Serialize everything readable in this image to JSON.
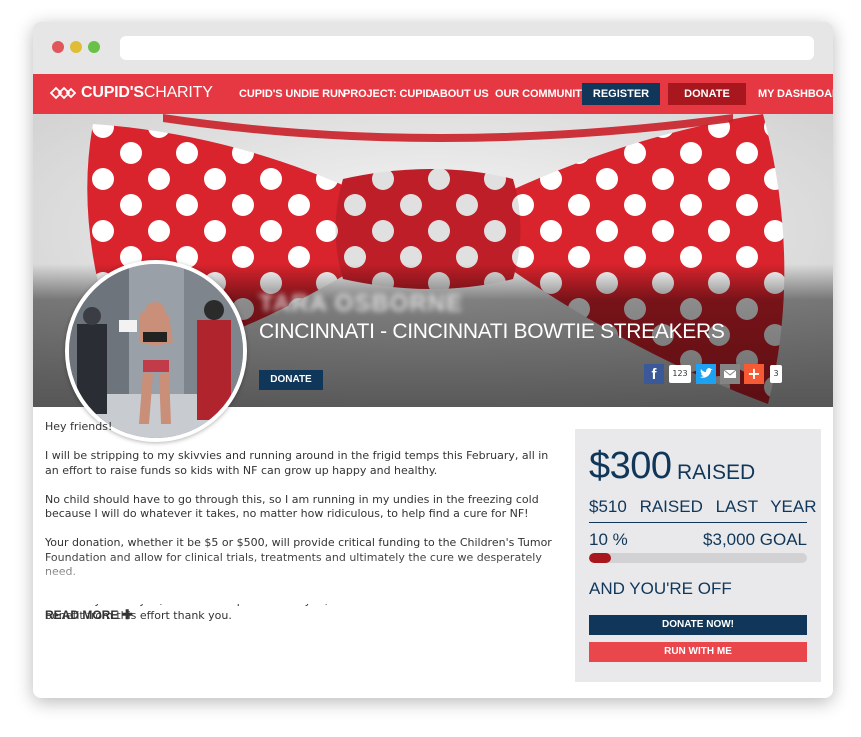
{
  "window": {
    "dots": [
      "#e0575b",
      "#dfbd37",
      "#6ac148"
    ]
  },
  "nav": {
    "logo_bold": "CUPID'S",
    "logo_light": "CHARITY",
    "items": [
      "CUPID'S UNDIE RUN",
      "PROJECT: CUPID",
      "ABOUT US",
      "OUR COMMUNITY"
    ],
    "register_label": "REGISTER",
    "donate_label": "DONATE",
    "dashboard_label": "MY DASHBOARD",
    "colors": {
      "bar": "#e63843",
      "register": "#10375a",
      "donate": "#a8171d"
    }
  },
  "hero": {
    "participant_name": "TARA OSBORNE",
    "team": "CINCINNATI - CINCINNATI BOWTIE STREAKERS",
    "donate_label": "DONATE",
    "share": {
      "facebook_icon": "facebook-icon",
      "facebook_count": "123",
      "twitter_icon": "twitter-icon",
      "email_icon": "email-icon",
      "plus_icon": "plus-icon",
      "plus_count": "3"
    }
  },
  "story": {
    "paragraphs": [
      "Hey friends!",
      "I will be stripping to my skivvies and running around in the frigid temps this February, all in an effort to raise funds so kids with NF can grow up happy and healthy.",
      "No child should have to go through this, so I am running in my undies in the freezing cold because I will do whatever it takes, no matter how ridiculous, to help find a cure for NF!",
      "Your donation, whether it be $5 or $500, will provide critical funding to the Children's Tumor Foundation and allow for clinical trials, treatments and ultimately the cure we desperately need.",
      "I sincerely thank you, our NF champions thank you, and the millions of families who will benefit from this effort thank you."
    ],
    "read_more": "READ MORE",
    "read_more_icon": "plus-icon"
  },
  "fundraising": {
    "raised": "$300",
    "raised_label": "RAISED",
    "last_year_amount": "$510",
    "last_year_label": "RAISED LAST YEAR",
    "percent_label": "10 %",
    "progress_fraction": 0.1,
    "goal": "$3,000 GOAL",
    "status": "AND YOU'RE OFF",
    "donate_now_label": "DONATE NOW!",
    "run_with_me_label": "RUN WITH ME"
  }
}
